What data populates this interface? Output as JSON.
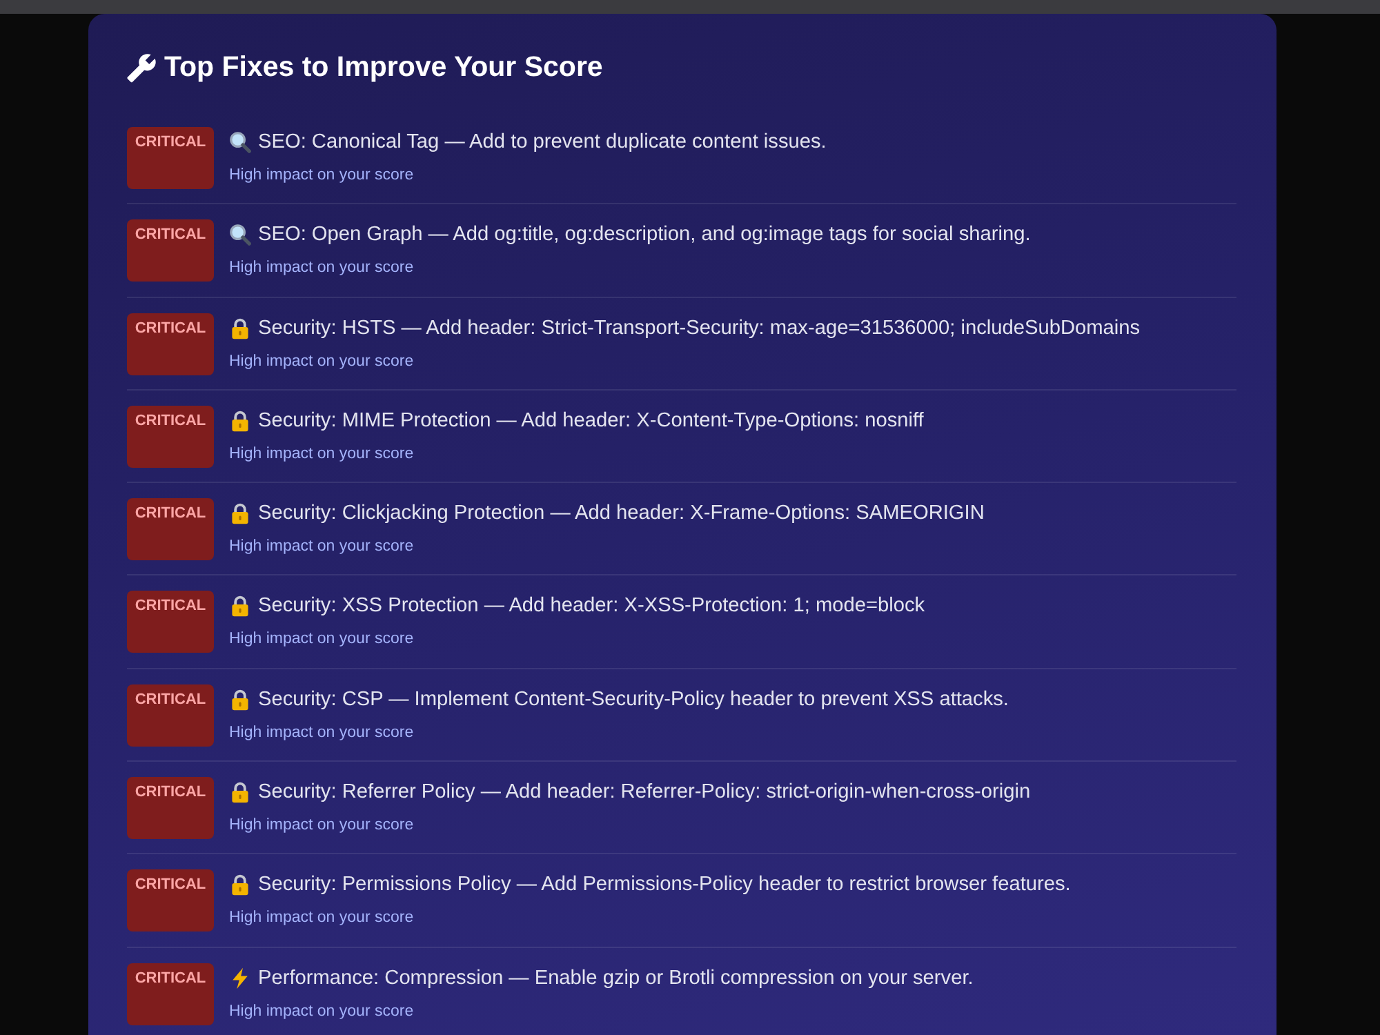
{
  "panel": {
    "title": "Top Fixes to Improve Your Score"
  },
  "fixes": [
    {
      "kind": "seo",
      "badge": "CRITICAL",
      "text": "SEO: Canonical Tag — Add to prevent duplicate content issues.",
      "note": "High impact on your score"
    },
    {
      "kind": "seo",
      "badge": "CRITICAL",
      "text": "SEO: Open Graph — Add og:title, og:description, and og:image tags for social sharing.",
      "note": "High impact on your score"
    },
    {
      "kind": "security",
      "badge": "CRITICAL",
      "text": "Security: HSTS — Add header: Strict-Transport-Security: max-age=31536000; includeSubDomains",
      "note": "High impact on your score"
    },
    {
      "kind": "security",
      "badge": "CRITICAL",
      "text": "Security: MIME Protection — Add header: X-Content-Type-Options: nosniff",
      "note": "High impact on your score"
    },
    {
      "kind": "security",
      "badge": "CRITICAL",
      "text": "Security: Clickjacking Protection — Add header: X-Frame-Options: SAMEORIGIN",
      "note": "High impact on your score"
    },
    {
      "kind": "security",
      "badge": "CRITICAL",
      "text": "Security: XSS Protection — Add header: X-XSS-Protection: 1; mode=block",
      "note": "High impact on your score"
    },
    {
      "kind": "security",
      "badge": "CRITICAL",
      "text": "Security: CSP — Implement Content-Security-Policy header to prevent XSS attacks.",
      "note": "High impact on your score"
    },
    {
      "kind": "security",
      "badge": "CRITICAL",
      "text": "Security: Referrer Policy — Add header: Referrer-Policy: strict-origin-when-cross-origin",
      "note": "High impact on your score"
    },
    {
      "kind": "security",
      "badge": "CRITICAL",
      "text": "Security: Permissions Policy — Add Permissions-Policy header to restrict browser features.",
      "note": "High impact on your score"
    },
    {
      "kind": "performance",
      "badge": "CRITICAL",
      "text": "Performance: Compression — Enable gzip or Brotli compression on your server.",
      "note": "High impact on your score"
    }
  ]
}
